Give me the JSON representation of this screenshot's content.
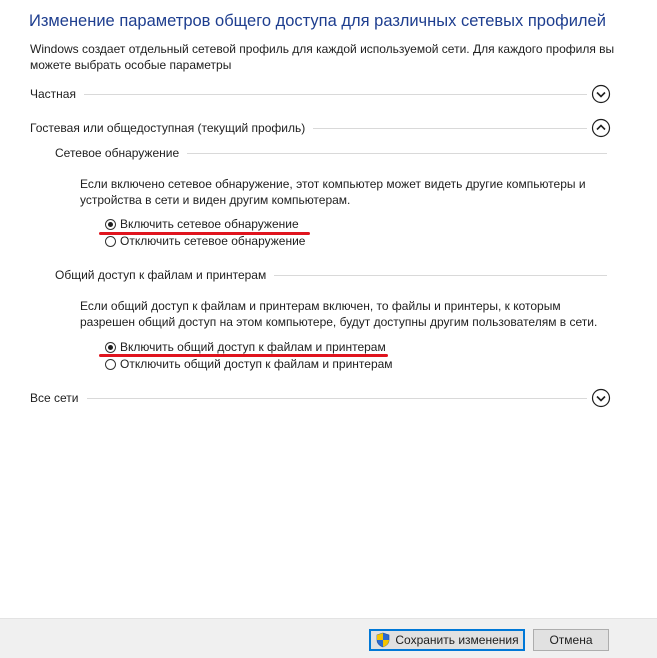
{
  "title": "Изменение параметров общего доступа для различных сетевых профилей",
  "description": "Windows создает отдельный сетевой профиль для каждой используемой сети. Для каждого профиля вы можете выбрать особые параметры",
  "sections": {
    "private": {
      "label": "Частная",
      "expanded": false,
      "chevron_icon": "chevron-down-icon"
    },
    "guest": {
      "label": "Гостевая или общедоступная (текущий профиль)",
      "expanded": true,
      "chevron_icon": "chevron-up-icon"
    },
    "all": {
      "label": "Все сети",
      "expanded": false,
      "chevron_icon": "chevron-down-icon"
    }
  },
  "discovery": {
    "heading": "Сетевое обнаружение",
    "description": "Если включено сетевое обнаружение, этот компьютер может видеть другие компьютеры и устройства в сети и виден другим компьютерам.",
    "option_on": "Включить сетевое обнаружение",
    "option_off": "Отключить сетевое обнаружение",
    "selected": "on"
  },
  "sharing": {
    "heading": "Общий доступ к файлам и принтерам",
    "description": "Если общий доступ к файлам и принтерам включен, то файлы и принтеры, к которым разрешен общий доступ на этом компьютере, будут доступны другим пользователям в сети.",
    "option_on": "Включить общий доступ к файлам и принтерам",
    "option_off": "Отключить общий доступ к файлам и принтерам",
    "selected": "on"
  },
  "buttons": {
    "save": "Сохранить изменения",
    "save_icon": "uac-shield-icon",
    "cancel": "Отмена"
  },
  "colors": {
    "title": "#1e3e8f",
    "annotation_underline": "#e0141e",
    "focus_border": "#0078d7"
  }
}
